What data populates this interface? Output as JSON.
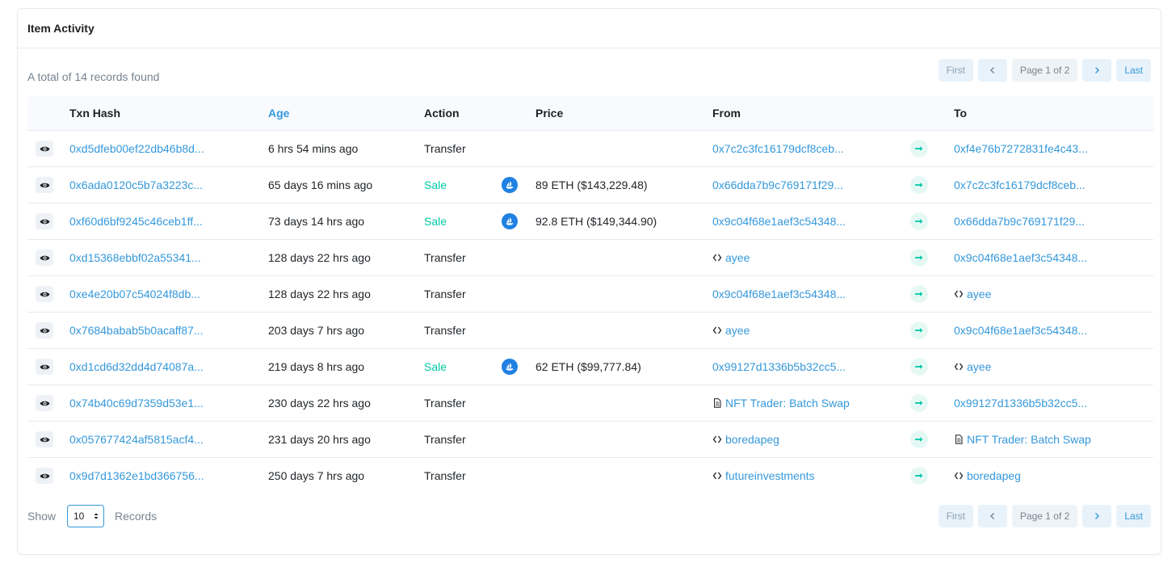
{
  "header": {
    "title": "Item Activity"
  },
  "summary": "A total of 14 records found",
  "pager": {
    "first": "First",
    "page": "Page 1 of 2",
    "last": "Last"
  },
  "table": {
    "columns": [
      "Txn Hash",
      "Age",
      "Action",
      "Price",
      "From",
      "To"
    ],
    "rows": [
      {
        "hash": "0xd5dfeb00ef22db46b8d...",
        "age": "6 hrs 54 mins ago",
        "action": "Transfer",
        "sale": false,
        "price": "",
        "from": "0x7c2c3fc16179dcf8ceb...",
        "from_kind": "address",
        "to": "0xf4e76b7272831fe4c43...",
        "to_kind": "address"
      },
      {
        "hash": "0x6ada0120c5b7a3223c...",
        "age": "65 days 16 mins ago",
        "action": "Sale",
        "sale": true,
        "price": "89 ETH ($143,229.48)",
        "from": "0x66dda7b9c769171f29...",
        "from_kind": "address",
        "to": "0x7c2c3fc16179dcf8ceb...",
        "to_kind": "address"
      },
      {
        "hash": "0xf60d6bf9245c46ceb1ff...",
        "age": "73 days 14 hrs ago",
        "action": "Sale",
        "sale": true,
        "price": "92.8 ETH ($149,344.90)",
        "from": "0x9c04f68e1aef3c54348...",
        "from_kind": "address",
        "to": "0x66dda7b9c769171f29...",
        "to_kind": "address"
      },
      {
        "hash": "0xd15368ebbf02a55341...",
        "age": "128 days 22 hrs ago",
        "action": "Transfer",
        "sale": false,
        "price": "",
        "from": "ayee",
        "from_kind": "ens",
        "to": "0x9c04f68e1aef3c54348...",
        "to_kind": "address"
      },
      {
        "hash": "0xe4e20b07c54024f8db...",
        "age": "128 days 22 hrs ago",
        "action": "Transfer",
        "sale": false,
        "price": "",
        "from": "0x9c04f68e1aef3c54348...",
        "from_kind": "address",
        "to": "ayee",
        "to_kind": "ens"
      },
      {
        "hash": "0x7684babab5b0acaff87...",
        "age": "203 days 7 hrs ago",
        "action": "Transfer",
        "sale": false,
        "price": "",
        "from": "ayee",
        "from_kind": "ens",
        "to": "0x9c04f68e1aef3c54348...",
        "to_kind": "address"
      },
      {
        "hash": "0xd1cd6d32dd4d74087a...",
        "age": "219 days 8 hrs ago",
        "action": "Sale",
        "sale": true,
        "price": "62 ETH ($99,777.84)",
        "from": "0x99127d1336b5b32cc5...",
        "from_kind": "address",
        "to": "ayee",
        "to_kind": "ens"
      },
      {
        "hash": "0x74b40c69d7359d53e1...",
        "age": "230 days 22 hrs ago",
        "action": "Transfer",
        "sale": false,
        "price": "",
        "from": "NFT Trader: Batch Swap",
        "from_kind": "contract",
        "to": "0x99127d1336b5b32cc5...",
        "to_kind": "address"
      },
      {
        "hash": "0x057677424af5815acf4...",
        "age": "231 days 20 hrs ago",
        "action": "Transfer",
        "sale": false,
        "price": "",
        "from": "boredapeg",
        "from_kind": "ens",
        "to": "NFT Trader: Batch Swap",
        "to_kind": "contract"
      },
      {
        "hash": "0x9d7d1362e1bd366756...",
        "age": "250 days 7 hrs ago",
        "action": "Transfer",
        "sale": false,
        "price": "",
        "from": "futureinvestments",
        "from_kind": "ens",
        "to": "boredapeg",
        "to_kind": "ens"
      }
    ]
  },
  "footer": {
    "show": "Show",
    "page_size": "10",
    "records": "Records"
  },
  "colors": {
    "link": "#3498db",
    "sale": "#00c9a7",
    "opensea": "#2081e2"
  }
}
